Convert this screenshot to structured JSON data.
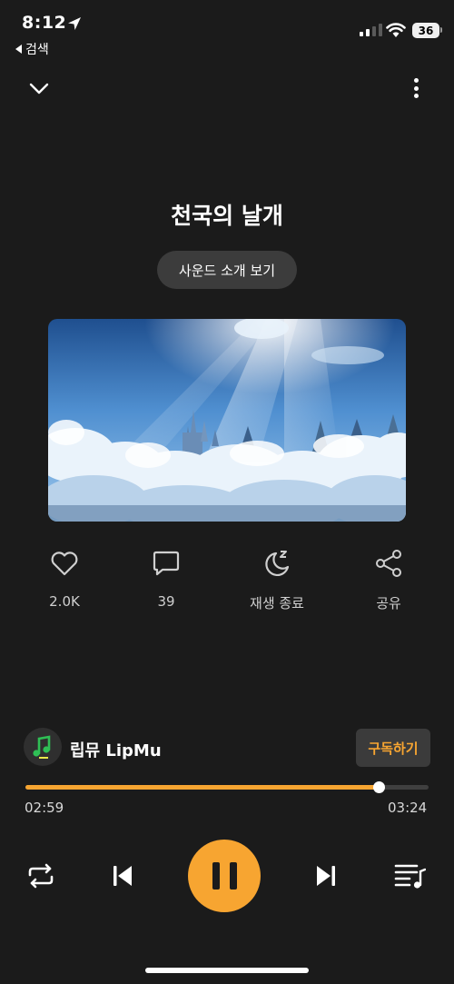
{
  "status_bar": {
    "time": "8:12",
    "back_label": "검색",
    "battery": "36"
  },
  "header": {
    "collapse_icon": "chevron-down-icon",
    "more_icon": "more-vertical-icon"
  },
  "track": {
    "title": "천국의 날개",
    "intro_button": "사운드 소개 보기"
  },
  "actions": [
    {
      "icon": "heart-icon",
      "label": "2.0K"
    },
    {
      "icon": "comment-icon",
      "label": "39"
    },
    {
      "icon": "moon-sleep-icon",
      "label": "재생 종료"
    },
    {
      "icon": "share-icon",
      "label": "공유"
    }
  ],
  "channel": {
    "name": "립뮤 LipMu",
    "subscribe_label": "구독하기"
  },
  "progress": {
    "current": "02:59",
    "total": "03:24",
    "fraction": 0.877
  },
  "colors": {
    "accent": "#f7a531",
    "background": "#1b1b1b"
  }
}
